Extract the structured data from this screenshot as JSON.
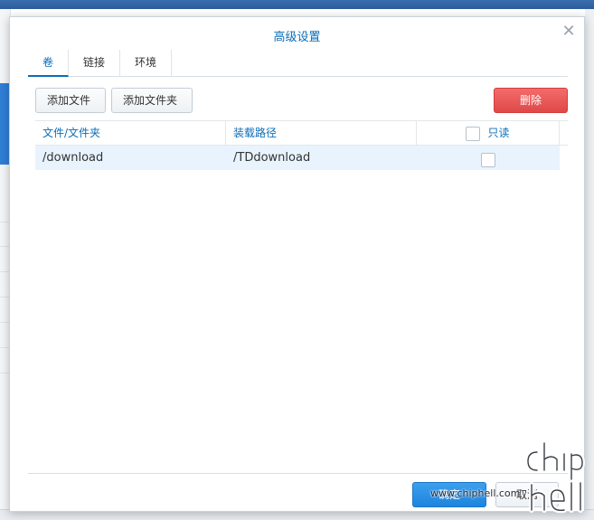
{
  "dialog": {
    "title": "高级设置",
    "close_label": "✕"
  },
  "tabs": [
    {
      "label": "卷",
      "active": true
    },
    {
      "label": "链接",
      "active": false
    },
    {
      "label": "环境",
      "active": false
    }
  ],
  "toolbar": {
    "add_file_label": "添加文件",
    "add_folder_label": "添加文件夹",
    "delete_label": "删除"
  },
  "grid": {
    "columns": [
      "文件/文件夹",
      "装载路径",
      "只读"
    ],
    "rows": [
      {
        "folder": "/download",
        "mount_path": "/TDdownload",
        "read_only": false
      }
    ]
  },
  "footer": {
    "ok_label": "确定",
    "cancel_label": "取消"
  },
  "watermark": {
    "url": "www.chiphell.com"
  },
  "colors": {
    "accent": "#0b6db7",
    "delete": "#e04848",
    "ok": "#1d84de",
    "row_highlight": "#e8f3fd"
  }
}
